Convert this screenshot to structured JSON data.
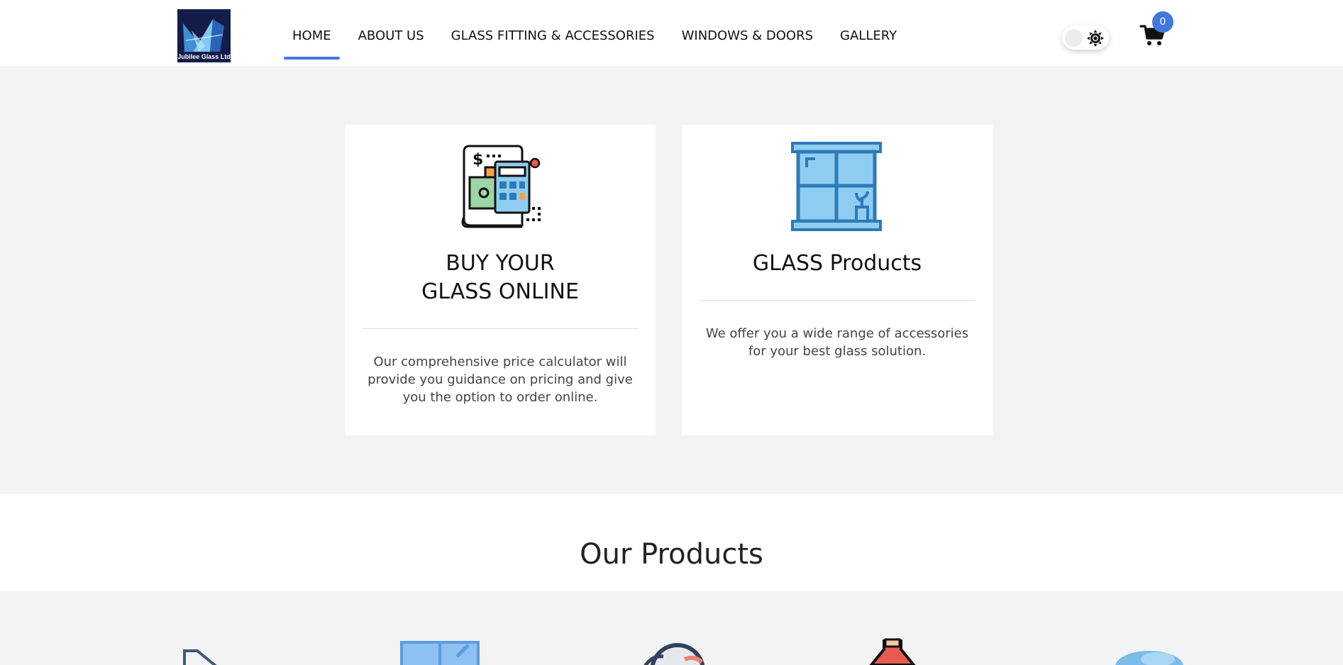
{
  "header": {
    "logo_text": "Jubilee Glass Ltd",
    "nav": [
      {
        "label": "HOME",
        "active": true
      },
      {
        "label": "ABOUT US"
      },
      {
        "label": "GLASS FITTING & ACCESSORIES"
      },
      {
        "label": "WINDOWS & DOORS"
      },
      {
        "label": "GALLERY"
      }
    ],
    "theme_toggle_icon": "sun-icon",
    "cart_icon": "cart-icon",
    "cart_count": "0"
  },
  "features": [
    {
      "icon": "price-calculator-icon",
      "title_lines": [
        "BUY YOUR",
        "GLASS ONLINE"
      ],
      "description": "Our comprehensive price calculator will provide you guidance on pricing and give you the option to order online."
    },
    {
      "icon": "glass-window-icon",
      "title_lines": [
        "GLASS Products"
      ],
      "description": "We offer you a wide range of accessories for your best glass solution."
    }
  ],
  "products": {
    "title": "Our Products",
    "icons": [
      "shower-door-icon",
      "window-cleaning-icon",
      "magnifier-icon",
      "glass-bottle-icon",
      "glass-shape-icon"
    ]
  },
  "colors": {
    "accent": "#3f78de",
    "logo_bg": "#141d4a",
    "page_bg": "#f3f3f3",
    "window_blue": "#8ecdf0",
    "window_frame": "#2c7ab8"
  }
}
